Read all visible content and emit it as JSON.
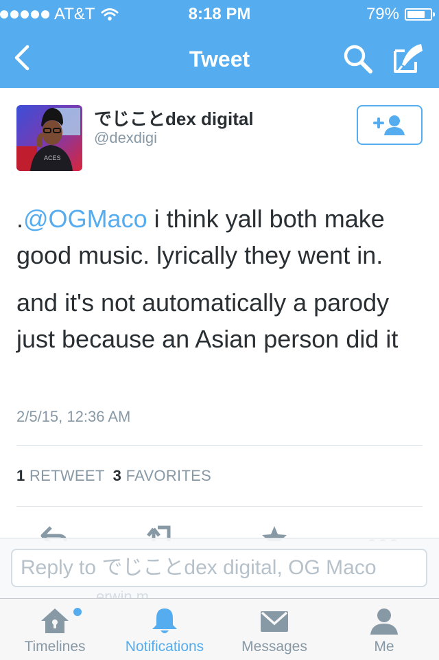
{
  "status_bar": {
    "carrier": "AT&T",
    "time": "8:18 PM",
    "battery": "79%",
    "battery_level": 0.79
  },
  "nav": {
    "title": "Tweet",
    "icons": [
      "back-chevron-icon",
      "search-icon",
      "compose-icon"
    ]
  },
  "tweet": {
    "display_name": "でじことdex digital",
    "handle": "@dexdigi",
    "text_prefix": ".",
    "mention": "@OGMaco",
    "text_line1_rest": " i think yall both make good music. lyrically they went in.",
    "text_para2": "and it's not automatically a parody just because an Asian person did it",
    "timestamp": "2/5/15, 12:36 AM",
    "retweet_count": "1",
    "retweet_label": "RETWEET",
    "favorite_count": "3",
    "favorite_label": "FAVORITES"
  },
  "reply": {
    "placeholder": "Reply to でじことdex digital, OG Maco",
    "ghost_text": "erwin m"
  },
  "tabs": [
    {
      "label": "Timelines",
      "icon": "home-icon"
    },
    {
      "label": "Notifications",
      "icon": "bell-icon"
    },
    {
      "label": "Messages",
      "icon": "envelope-icon"
    },
    {
      "label": "Me",
      "icon": "person-icon"
    }
  ],
  "colors": {
    "brand_blue": "#55acee",
    "text": "#292f33",
    "muted": "#8899a6"
  }
}
